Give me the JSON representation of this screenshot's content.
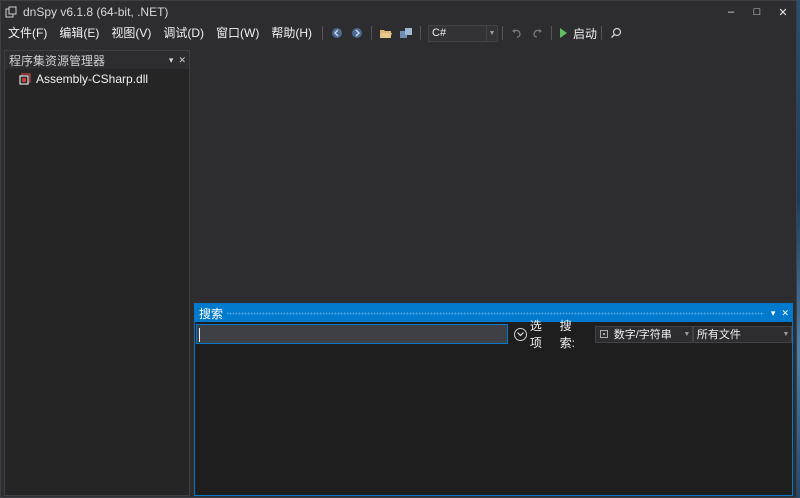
{
  "window": {
    "title": "dnSpy v6.1.8 (64-bit, .NET)",
    "controls": {
      "minimize": "–",
      "maximize": "□",
      "close": "✕"
    }
  },
  "menu": {
    "items": [
      {
        "label": "文件(F)"
      },
      {
        "label": "编辑(E)"
      },
      {
        "label": "视图(V)"
      },
      {
        "label": "调试(D)"
      },
      {
        "label": "窗口(W)"
      },
      {
        "label": "帮助(H)"
      }
    ]
  },
  "toolbar": {
    "icons": [
      "back-icon",
      "forward-icon",
      "open-folder-icon",
      "open-list-icon",
      "undo-icon",
      "redo-icon",
      "search-icon"
    ],
    "language": "C#",
    "start_label": "启动",
    "colors": {
      "play": "#5fbf5f",
      "accent": "#007acc"
    }
  },
  "explorer": {
    "title": "程序集资源管理器",
    "pin": "▾",
    "close": "✕",
    "items": [
      {
        "label": "Assembly-CSharp.dll",
        "icon": "assembly-icon"
      }
    ]
  },
  "search": {
    "title": "搜索",
    "pin": "▾",
    "close": "✕",
    "input_value": "",
    "options_label": "选项",
    "search_label": "搜索:",
    "type_value": "数字/字符串",
    "scope_value": "所有文件"
  }
}
